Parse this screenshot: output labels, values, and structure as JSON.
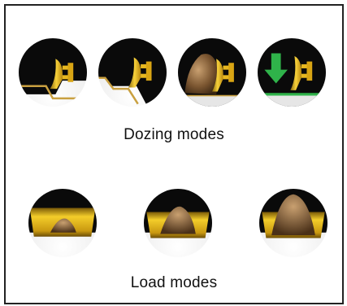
{
  "dozing_section": {
    "caption": "Dozing modes",
    "modes": [
      {
        "icon": "dozer-blade-cut-icon"
      },
      {
        "icon": "dozer-blade-slope-cut-icon"
      },
      {
        "icon": "dozer-blade-carry-icon"
      },
      {
        "icon": "dozer-blade-spread-down-icon"
      }
    ]
  },
  "load_section": {
    "caption": "Load modes",
    "modes": [
      {
        "icon": "blade-load-light-icon",
        "level": "light"
      },
      {
        "icon": "blade-load-medium-icon",
        "level": "medium"
      },
      {
        "icon": "blade-load-heavy-icon",
        "level": "heavy"
      }
    ]
  },
  "colors": {
    "blade_yellow": "#f2c21b",
    "circle_black": "#0a0a0a",
    "accent_green": "#2fb34a",
    "dirt_brown": "#7a5530"
  }
}
